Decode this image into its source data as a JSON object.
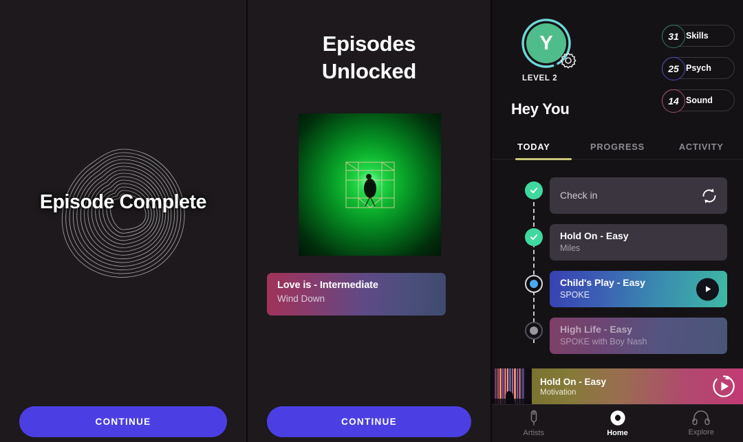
{
  "panels": {
    "left": {
      "title": "Episode Complete",
      "swirl_icon": "concentric-swirl-ring",
      "continue_label": "CONTINUE"
    },
    "mid": {
      "title_line1": "Episodes",
      "title_line2": "Unlocked",
      "album_art_alt": "green-glow-album-art",
      "track": {
        "title": "Love is - Intermediate",
        "subtitle": "Wind Down"
      },
      "lock_icon": "unlocked-padlock-icon",
      "continue_label": "CONTINUE"
    },
    "right": {
      "profile": {
        "avatar_initial": "Y",
        "level_label": "LEVEL 2",
        "greeting": "Hey You",
        "settings_icon": "gear-icon"
      },
      "stats": [
        {
          "value": "31",
          "label": "Skills",
          "color": "#2f7d5c"
        },
        {
          "value": "25",
          "label": "Psych",
          "color": "#4b4bbf"
        },
        {
          "value": "14",
          "label": "Sound",
          "color": "#a64f72"
        }
      ],
      "tabs": [
        {
          "label": "TODAY",
          "active": true
        },
        {
          "label": "PROGRESS",
          "active": false
        },
        {
          "label": "ACTIVITY",
          "active": false
        }
      ],
      "tab_underline_color": "#c9c77a",
      "tasks": [
        {
          "title": "Check in",
          "subtitle": "",
          "state": "done",
          "marker": "check",
          "action_icon": "refresh-sync-icon"
        },
        {
          "title": "Hold On - Easy",
          "subtitle": "Miles",
          "state": "done",
          "marker": "check",
          "action_icon": ""
        },
        {
          "title": "Child's Play - Easy",
          "subtitle": "SPOKE",
          "state": "active",
          "marker": "current",
          "action_icon": "play-icon"
        },
        {
          "title": "High Life - Easy",
          "subtitle": "SPOKE with Boy Nash",
          "state": "locked",
          "marker": "upcoming",
          "action_icon": ""
        }
      ],
      "now_playing": {
        "title": "Hold On - Easy",
        "subtitle": "Motivation",
        "play_icon": "play-replay-circle-icon",
        "thumb_alt": "concert-light-streaks-thumbnail"
      },
      "nav": [
        {
          "label": "Artists",
          "icon": "microphone-icon",
          "active": false
        },
        {
          "label": "Home",
          "icon": "home-blob-icon",
          "active": true
        },
        {
          "label": "Explore",
          "icon": "headphones-icon",
          "active": false
        }
      ]
    }
  }
}
